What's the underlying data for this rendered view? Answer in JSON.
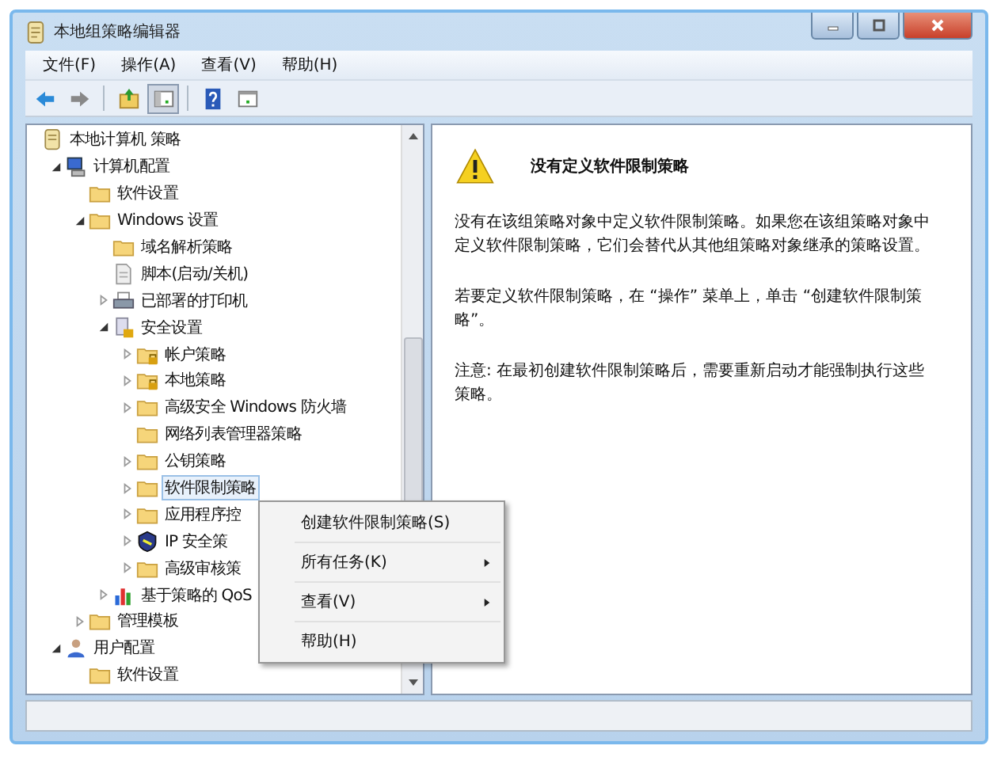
{
  "window": {
    "title": "本地组策略编辑器"
  },
  "menu": [
    "文件(F)",
    "操作(A)",
    "查看(V)",
    "帮助(H)"
  ],
  "toolbar": [
    {
      "kind": "back",
      "pressed": false
    },
    {
      "kind": "forward",
      "pressed": false
    },
    {
      "kind": "up",
      "pressed": false
    },
    {
      "kind": "tree",
      "pressed": true
    },
    {
      "kind": "help",
      "pressed": false
    },
    {
      "kind": "pane",
      "pressed": false
    }
  ],
  "tree": [
    {
      "label": "本地计算机 策略",
      "kind": "policy",
      "children": [
        {
          "label": "计算机配置",
          "kind": "computer",
          "expanded": true,
          "children": [
            {
              "label": "软件设置",
              "kind": "folder"
            },
            {
              "label": "Windows 设置",
              "kind": "folder",
              "expanded": true,
              "children": [
                {
                  "label": "域名解析策略",
                  "kind": "folder"
                },
                {
                  "label": "脚本(启动/关机)",
                  "kind": "script"
                },
                {
                  "label": "已部署的打印机",
                  "kind": "printer",
                  "expanded": false
                },
                {
                  "label": "安全设置",
                  "kind": "security",
                  "expanded": true,
                  "children": [
                    {
                      "label": "帐户策略",
                      "kind": "lockfolder",
                      "expanded": false
                    },
                    {
                      "label": "本地策略",
                      "kind": "lockfolder",
                      "expanded": false
                    },
                    {
                      "label": "高级安全 Windows 防火墙",
                      "kind": "folder",
                      "expanded": false
                    },
                    {
                      "label": "网络列表管理器策略",
                      "kind": "folder"
                    },
                    {
                      "label": "公钥策略",
                      "kind": "folder",
                      "expanded": false
                    },
                    {
                      "label": "软件限制策略",
                      "kind": "folder",
                      "expanded": false,
                      "selected": true
                    },
                    {
                      "label": "应用程序控",
                      "kind": "folder",
                      "expanded": false
                    },
                    {
                      "label": "IP 安全策",
                      "kind": "ip",
                      "expanded": false
                    },
                    {
                      "label": "高级审核策",
                      "kind": "folder",
                      "expanded": false
                    }
                  ]
                },
                {
                  "label": "基于策略的 QoS",
                  "kind": "chart",
                  "expanded": false
                }
              ]
            },
            {
              "label": "管理模板",
              "kind": "folder",
              "expanded": false
            }
          ]
        },
        {
          "label": "用户配置",
          "kind": "user",
          "expanded": true,
          "children": [
            {
              "label": "软件设置",
              "kind": "folder"
            }
          ]
        }
      ]
    }
  ],
  "context_menu": [
    {
      "label": "创建软件限制策略(S)",
      "submenu": false
    },
    {
      "label": "所有任务(K)",
      "submenu": true
    },
    {
      "label": "查看(V)",
      "submenu": true
    },
    {
      "label": "帮助(H)",
      "submenu": false
    }
  ],
  "details": {
    "heading": "没有定义软件限制策略",
    "paragraphs": [
      "没有在该组策略对象中定义软件限制策略。如果您在该组策略对象中定义软件限制策略，它们会替代从其他组策略对象继承的策略设置。",
      "若要定义软件限制策略，在 “操作” 菜单上，单击 “创建软件限制策略”。",
      "注意: 在最初创建软件限制策略后，需要重新启动才能强制执行这些策略。"
    ]
  }
}
